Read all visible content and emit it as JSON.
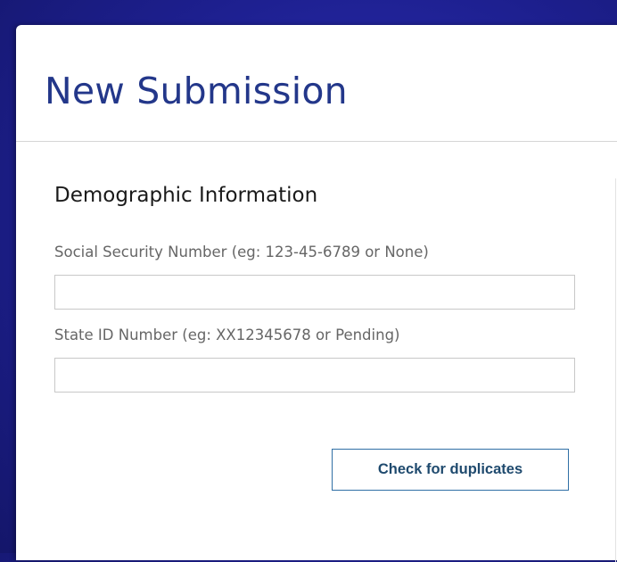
{
  "page": {
    "title": "New Submission"
  },
  "demographics": {
    "section_title": "Demographic Information",
    "ssn": {
      "label": "Social Security Number (eg: 123-45-6789 or None)",
      "value": ""
    },
    "state_id": {
      "label": "State ID Number (eg: XX12345678 or Pending)",
      "value": ""
    },
    "check_button_label": "Check for duplicates"
  },
  "colors": {
    "title": "#23378a",
    "button_border": "#2f6fa5",
    "button_text": "#1f4a6e",
    "background": "#1d1f8e"
  }
}
